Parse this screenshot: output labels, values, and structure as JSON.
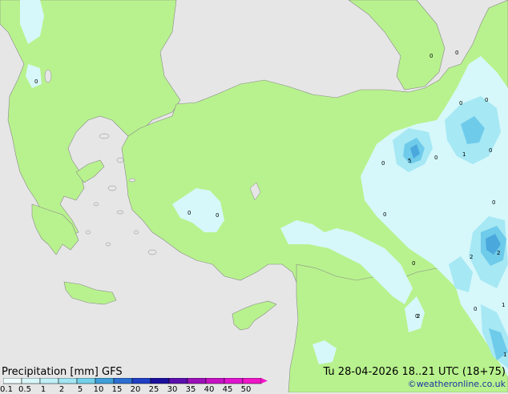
{
  "legend": {
    "title": "Precipitation [mm]  GFS",
    "ticks": [
      "0.1",
      "0.5",
      "1",
      "2",
      "5",
      "10",
      "15",
      "20",
      "25",
      "30",
      "35",
      "40",
      "45",
      "50"
    ],
    "colors": [
      "#eefcfd",
      "#d7f7fb",
      "#c0f0f8",
      "#a2e6f3",
      "#72d1ea",
      "#3f9fdb",
      "#2b6fd1",
      "#1f3fc4",
      "#1a0f9e",
      "#5a0fae",
      "#9b10b8",
      "#c712c4",
      "#e014d0",
      "#f016c8"
    ]
  },
  "valid_time": "Tu 28-04-2026  18..21 UTC (18+75)",
  "credit": "©weatheronline.co.uk",
  "colors": {
    "land": "#b8f28e",
    "sea": "#e6e6e6",
    "precip_light": "#d6f8fb",
    "precip_medium": "#a6e8f4",
    "precip_heavy": "#6fcbea",
    "precip_heavier": "#4aa8dd"
  },
  "point_marks": [
    {
      "label": "0"
    },
    {
      "label": "0"
    },
    {
      "label": "0"
    },
    {
      "label": "0"
    },
    {
      "label": "0"
    },
    {
      "label": "1"
    },
    {
      "label": "0"
    },
    {
      "label": "5"
    },
    {
      "label": "0"
    },
    {
      "label": "0"
    },
    {
      "label": "0"
    },
    {
      "label": "0"
    },
    {
      "label": "0"
    },
    {
      "label": "0"
    },
    {
      "label": "2"
    },
    {
      "label": "2"
    },
    {
      "label": "0"
    },
    {
      "label": "1"
    },
    {
      "label": "0"
    },
    {
      "label": "2"
    },
    {
      "label": "0"
    },
    {
      "label": "1"
    }
  ]
}
